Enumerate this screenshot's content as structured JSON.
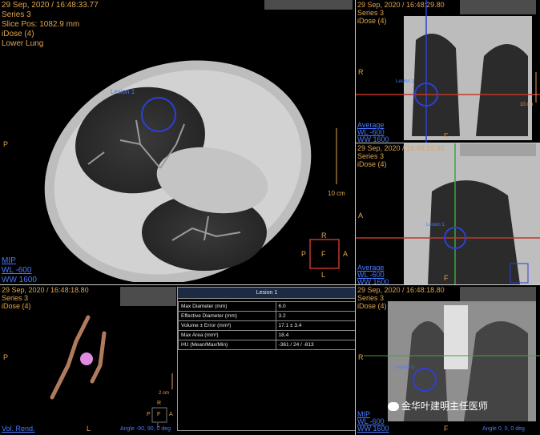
{
  "main": {
    "datetime": "29 Sep, 2020 / 16:48:33.77",
    "series": "Series 3",
    "slice_pos": "Slice Pos: 1082.9 mm",
    "idose": "iDose (4)",
    "protocol": "Lower Lung",
    "lesion_label": "Lesion 1",
    "scale": "10 cm",
    "orient_left": "P",
    "cube": {
      "top": "R",
      "left": "P",
      "center": "F",
      "right": "A",
      "bottom": "L"
    },
    "mode": "MIP",
    "wl": "WL  -600",
    "ww": "WW  1600"
  },
  "coronal": {
    "datetime": "29 Sep, 2020 / 16:48:29.80",
    "series": "Series 3",
    "idose": "iDose (4)",
    "lesion_label": "Lesion 1",
    "orient_left": "R",
    "orient_bottom": "F",
    "scale": "10 cm",
    "mode": "Average",
    "wl": "WL  -600",
    "ww": "WW  1600"
  },
  "sagittal": {
    "datetime": "29 Sep, 2020 / 16:48:29.80",
    "series": "Series 3",
    "idose": "iDose (4)",
    "lesion_label": "Lesion 1",
    "orient_left": "A",
    "orient_bottom": "F",
    "mode": "Average",
    "wl": "WL  -600",
    "ww": "WW  1600"
  },
  "volume": {
    "datetime": "29 Sep, 2020 / 16:48:18.80",
    "series": "Series 3",
    "idose": "iDose (4)",
    "orient_left": "P",
    "scale": "2 cm",
    "cube": {
      "top": "R",
      "left": "P",
      "center": "F",
      "right": "A",
      "bottom": "L"
    },
    "mode": "Vol. Rend.",
    "orient_bottom": "L",
    "angle": "Angle -90, 90, 0  deg"
  },
  "measurement": {
    "title": "Lesion 1",
    "rows": [
      {
        "label": "Max Diameter (mm)",
        "value": "6.0"
      },
      {
        "label": "Effective Diameter (mm)",
        "value": "3.2"
      },
      {
        "label": "Volume ± Error (mm³)",
        "value": "17.1 ± 3.4"
      },
      {
        "label": "Max Area (mm²)",
        "value": "18.4"
      },
      {
        "label": "HU (Mean/Max/Min)",
        "value": "-361 / 24 / -813"
      }
    ]
  },
  "mip3d": {
    "datetime": "29 Sep, 2020 / 16:48:18.80",
    "series": "Series 3",
    "idose": "iDose (4)",
    "orient_left": "R",
    "orient_bottom": "F",
    "lesion_label": "Lesion 1",
    "mode": "MIP",
    "wl": "WL  -600",
    "ww": "WW  1600",
    "angle": "Angle 0, 0, 0  deg"
  },
  "watermark": "金华叶建明主任医师"
}
